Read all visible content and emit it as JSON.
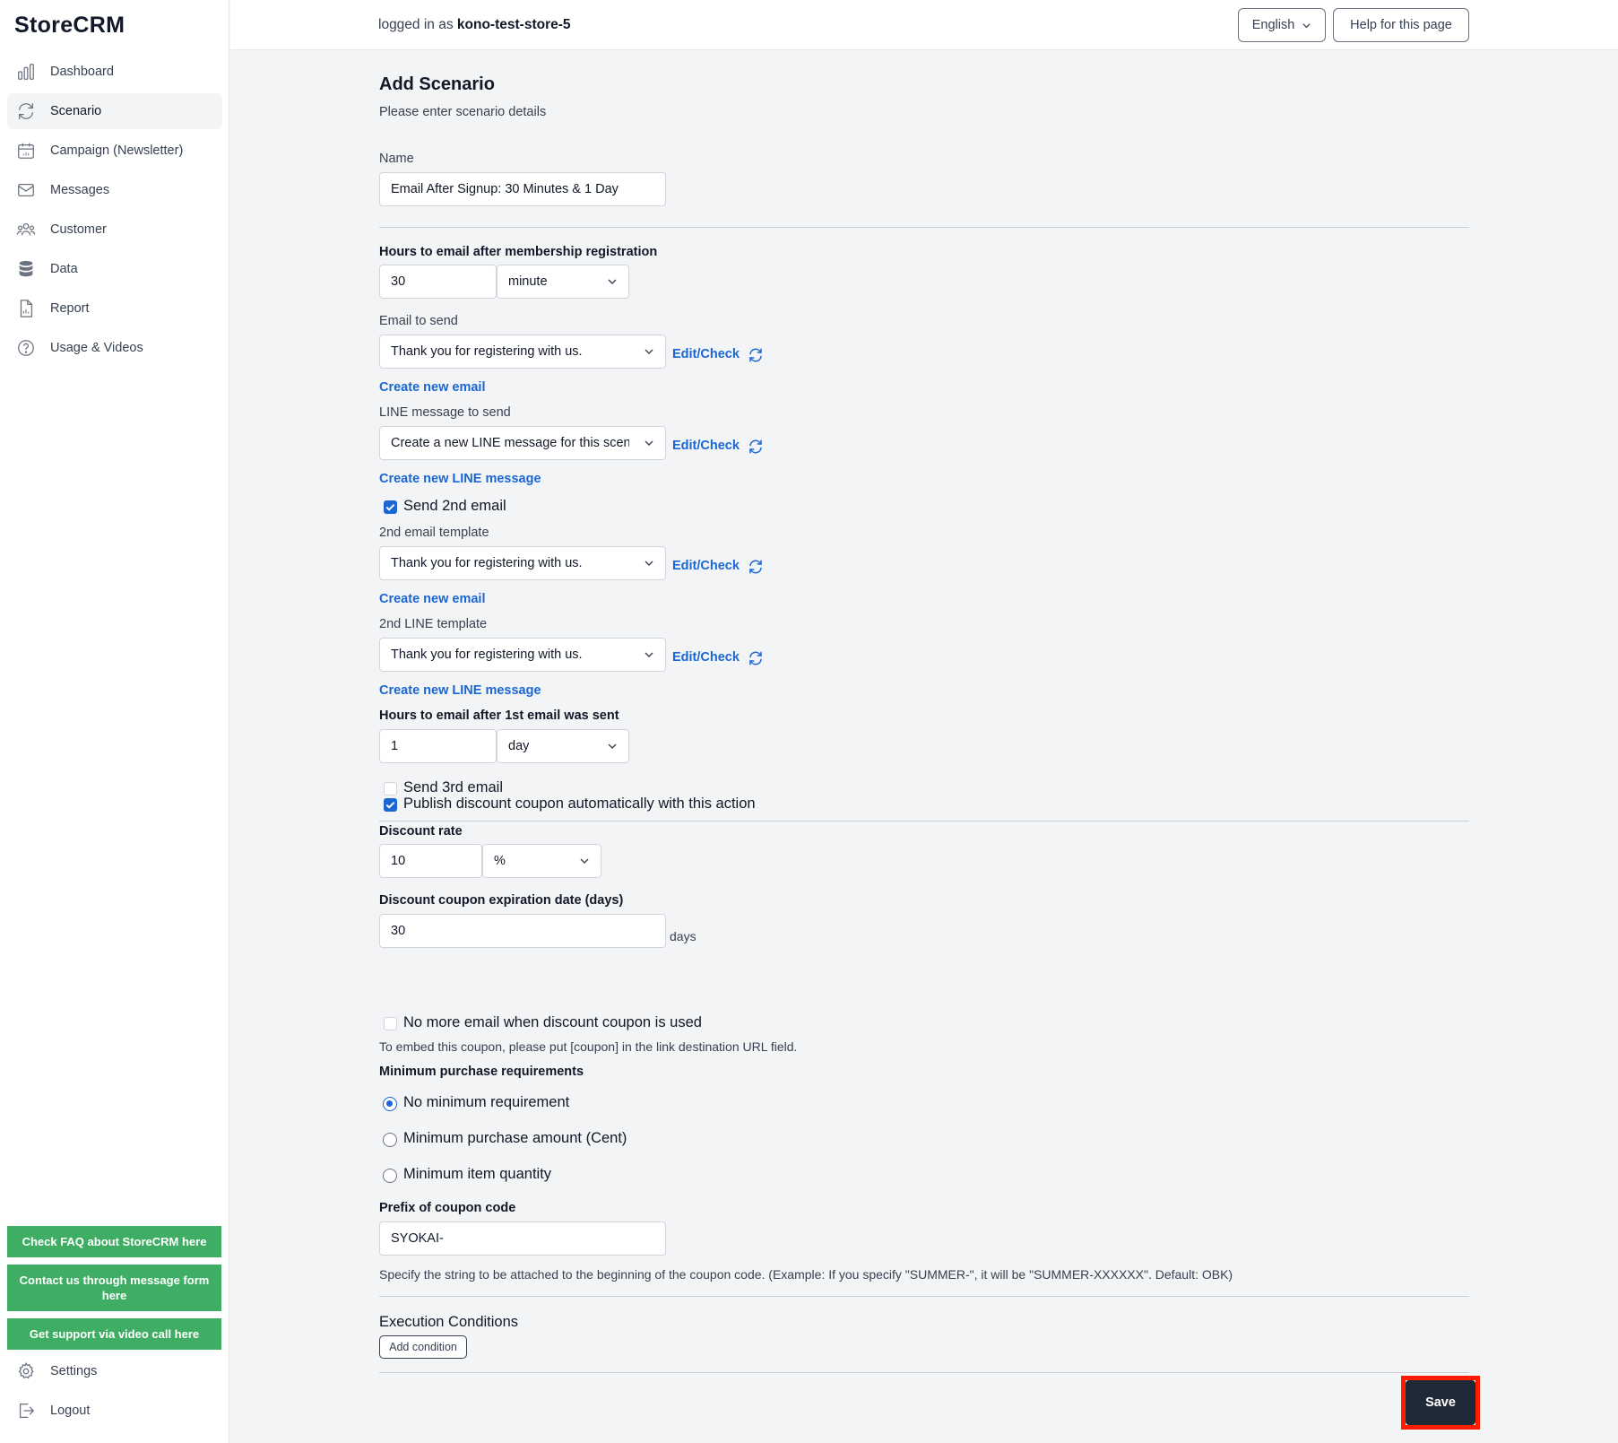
{
  "app": {
    "logo": "StoreCRM"
  },
  "sidebar": {
    "items": [
      {
        "label": "Dashboard",
        "icon": "bar-chart-icon"
      },
      {
        "label": "Scenario",
        "icon": "refresh-icon",
        "active": true
      },
      {
        "label": "Campaign (Newsletter)",
        "icon": "calendar-icon"
      },
      {
        "label": "Messages",
        "icon": "envelope-icon"
      },
      {
        "label": "Customer",
        "icon": "users-icon"
      },
      {
        "label": "Data",
        "icon": "database-icon"
      },
      {
        "label": "Report",
        "icon": "document-icon"
      },
      {
        "label": "Usage & Videos",
        "icon": "question-circle-icon"
      }
    ],
    "help_buttons": {
      "faq": "Check FAQ about StoreCRM here",
      "contact": "Contact us through message form here",
      "video": "Get support via video call here"
    },
    "settings": "Settings",
    "logout": "Logout",
    "accent": "#3fae64"
  },
  "header": {
    "logged_prefix": "logged in as",
    "store": "kono-test-store-5",
    "language": "English",
    "help": "Help for this page"
  },
  "form": {
    "title": "Add Scenario",
    "subtitle": "Please enter scenario details",
    "name_label": "Name",
    "name_value": "Email After Signup: 30 Minutes & 1 Day",
    "hours_label": "Hours to email after membership registration",
    "hours_value": "30",
    "hours_unit": "minute",
    "email_label": "Email to send",
    "email_value": "Thank you for registering with us.",
    "edit_check": "Edit/Check",
    "create_email": "Create new email",
    "line_label": "LINE message to send",
    "line_value": "Create a new LINE message for this scenario",
    "create_line": "Create new LINE message",
    "send2": "Send 2nd email",
    "email2_label": "2nd email template",
    "email2_value": "Thank you for registering with us.",
    "line2_label": "2nd LINE template",
    "line2_value": "Thank you for registering with us.",
    "hours2_label": "Hours to email after 1st email was sent",
    "hours2_value": "1",
    "hours2_unit": "day",
    "send3": "Send 3rd email",
    "publish_coupon": "Publish discount coupon automatically with this action",
    "discount_label": "Discount rate",
    "discount_value": "10",
    "discount_unit": "%",
    "expire_label": "Discount coupon expiration date (days)",
    "expire_value": "30",
    "expire_suffix": "days",
    "no_more_email": "No more email when discount coupon is used",
    "embed_note": "To embed this coupon, please put [coupon] in the link destination URL field.",
    "min_label": "Minimum purchase requirements",
    "min_none": "No minimum requirement",
    "min_amount": "Minimum purchase amount (Cent)",
    "min_qty": "Minimum item quantity",
    "prefix_label": "Prefix of coupon code",
    "prefix_value": "SYOKAI-",
    "prefix_note": "Specify the string to be attached to the beginning of the coupon code. (Example: If you specify \"SUMMER-\", it will be \"SUMMER-XXXXXX\". Default: OBK)",
    "exec_title": "Execution Conditions",
    "add_condition": "Add condition",
    "save": "Save",
    "link_color": "#1a66d2",
    "highlight_color": "#ff1a00"
  }
}
